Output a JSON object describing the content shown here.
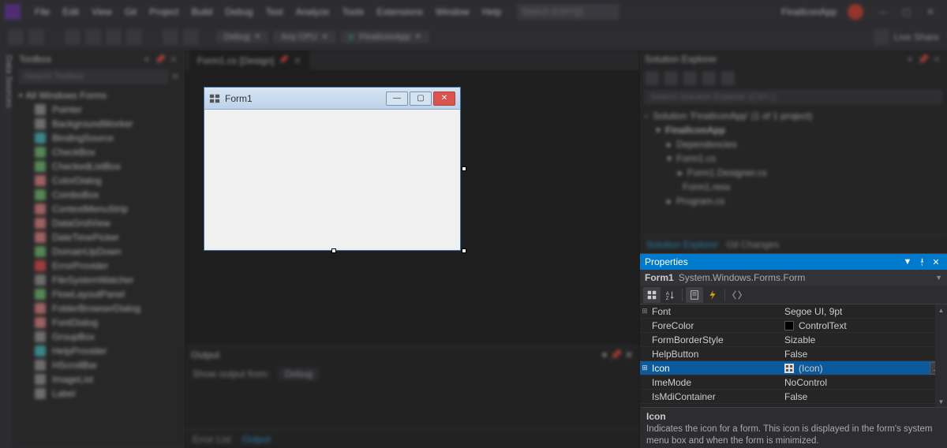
{
  "topbar": {
    "menus": [
      "File",
      "Edit",
      "View",
      "Git",
      "Project",
      "Build",
      "Debug",
      "Test",
      "Analyze",
      "Tools",
      "Extensions",
      "Window",
      "Help"
    ],
    "search_placeholder": "Search (Ctrl+Q)",
    "app_name": "FinalIconApp"
  },
  "toolbar": {
    "config": "Debug",
    "platform": "Any CPU",
    "start_label": "FinalIconApp",
    "live_share": "Live Share"
  },
  "left_rail": "Data Sources",
  "toolbox": {
    "title": "Toolbox",
    "search_placeholder": "Search Toolbox",
    "section": "All Windows Forms",
    "items": [
      "Pointer",
      "BackgroundWorker",
      "BindingSource",
      "CheckBox",
      "CheckedListBox",
      "ColorDialog",
      "ComboBox",
      "ContextMenuStrip",
      "DataGridView",
      "DateTimePicker",
      "DomainUpDown",
      "ErrorProvider",
      "FileSystemWatcher",
      "FlowLayoutPanel",
      "FolderBrowserDialog",
      "FontDialog",
      "GroupBox",
      "HelpProvider",
      "HScrollBar",
      "ImageList",
      "Label"
    ]
  },
  "document": {
    "tab_label": "Form1.cs [Design]",
    "form_title": "Form1"
  },
  "output": {
    "title": "Output",
    "show_label": "Show output from:",
    "source": "Debug"
  },
  "bottom_tabs": {
    "error_list": "Error List",
    "output": "Output"
  },
  "solution_explorer": {
    "title": "Solution Explorer",
    "search_placeholder": "Search Solution Explorer (Ctrl+;)",
    "solution_line": "Solution 'FinalIconApp' (1 of 1 project)",
    "project": "FinalIconApp",
    "nodes": [
      "Dependencies",
      "Form1.cs",
      "Form1.Designer.cs",
      "Form1.resx",
      "Program.cs"
    ],
    "tabs": {
      "se": "Solution Explorer",
      "git": "Git Changes"
    }
  },
  "properties": {
    "title": "Properties",
    "object_name": "Form1",
    "type_name": "System.Windows.Forms.Form",
    "rows": [
      {
        "expand": "+",
        "name": "Font",
        "value": "Segoe UI, 9pt"
      },
      {
        "expand": "",
        "name": "ForeColor",
        "value": "ControlText",
        "swatch": true
      },
      {
        "expand": "",
        "name": "FormBorderStyle",
        "value": "Sizable"
      },
      {
        "expand": "",
        "name": "HelpButton",
        "value": "False"
      },
      {
        "expand": "+",
        "name": "Icon",
        "value": "(Icon)",
        "selected": true,
        "ellipsis": true,
        "icon_preview": true
      },
      {
        "expand": "",
        "name": "ImeMode",
        "value": "NoControl"
      },
      {
        "expand": "",
        "name": "IsMdiContainer",
        "value": "False"
      }
    ],
    "desc_title": "Icon",
    "desc_text": "Indicates the icon for a form. This icon is displayed in the form's system menu box and when the form is minimized."
  }
}
